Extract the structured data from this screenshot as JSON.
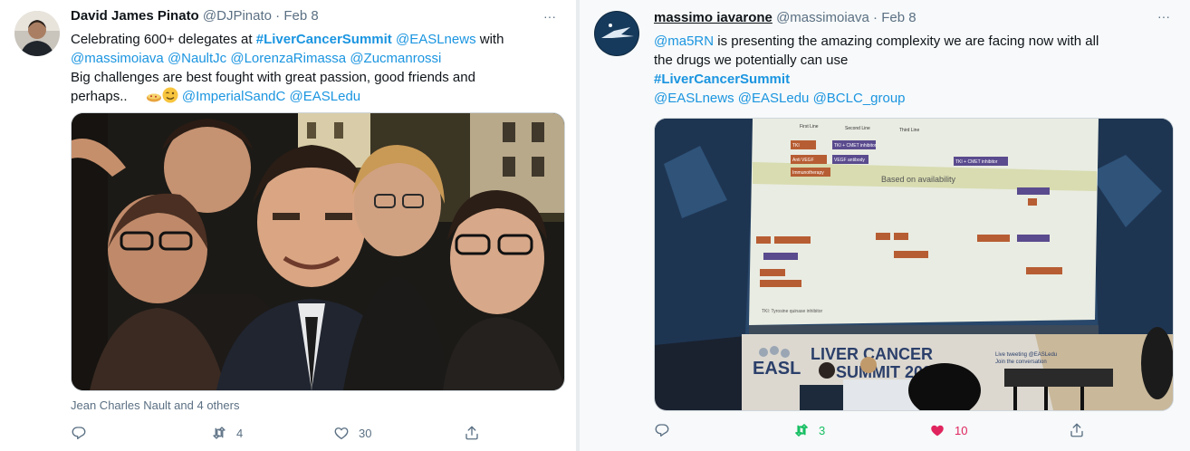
{
  "tweet1": {
    "name": "David James Pinato",
    "handle": "@DJPinato",
    "dot": "·",
    "date": "Feb 8",
    "more": "···",
    "text": {
      "l1_a": "Celebrating 600+ delegates at ",
      "l1_tag": "#LiverCancerSummit",
      "l1_sp": " ",
      "l1_m": "@EASLnews",
      "l1_b": " with",
      "l2": [
        "@massimoiava",
        "@NaultJc",
        "@LorenzaRimassa",
        "@Zucmanrossi"
      ],
      "l3": "Big challenges are best fought with great passion, good friends and",
      "l4_a": "perhaps..",
      "l4_m1": "@ImperialSandC",
      "l4_m2": "@EASLedu"
    },
    "tagged": "Jean Charles Nault and 4 others",
    "actions": {
      "retweets": "4",
      "likes": "30"
    }
  },
  "tweet2": {
    "name": "massimo iavarone",
    "handle": "@massimoiava",
    "dot": "·",
    "date": "Feb 8",
    "more": "···",
    "text": {
      "l1_m": "@ma5RN",
      "l1_b": " is presenting the amazing complexity we are facing now with all",
      "l2": "the drugs we potentially can use",
      "l3_tag": "#LiverCancerSummit",
      "l4": [
        "@EASLnews",
        "@EASLedu",
        "@BCLC_group"
      ]
    },
    "slide": {
      "headers": [
        "First Line",
        "Second Line",
        "Third Line"
      ],
      "chips": [
        "TKI",
        "TKI + CMET inhibitor",
        "Anti VEGF",
        "VEGF antibody",
        "Immunotherapy",
        "TKI + CMET inhibitor"
      ],
      "title": "Based on availability",
      "footnote": "TKI: Tyrosine quinase inhibitor"
    },
    "banner": {
      "brand": "EASL",
      "title1": "LIVER CANCER",
      "title2": "SUMMIT 2020",
      "side1": "Live tweeting @EASLedu",
      "side2": "Join the conversation"
    },
    "actions": {
      "retweets": "3",
      "likes": "10"
    }
  },
  "colors": {
    "link": "#1b95e0",
    "muted": "#5b7083",
    "retweeted": "#17bf63",
    "liked": "#e0245e"
  },
  "icons": [
    "reply-icon",
    "retweet-icon",
    "like-icon",
    "share-icon",
    "more-icon"
  ]
}
